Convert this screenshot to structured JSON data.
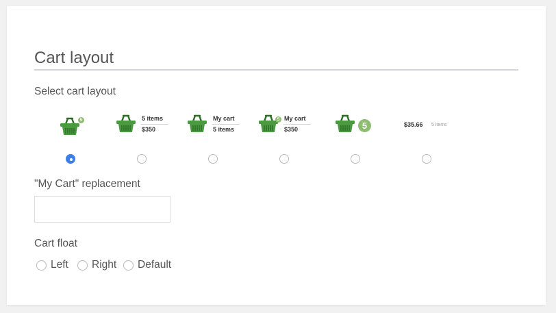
{
  "section": {
    "title": "Cart layout"
  },
  "layout": {
    "label": "Select cart layout",
    "selected_index": 0,
    "options": [
      {
        "type": "icon-badge",
        "badge": "5"
      },
      {
        "type": "icon-two-line",
        "line1": "5 items",
        "line2": "$350"
      },
      {
        "type": "icon-two-line",
        "line1": "My cart",
        "line2": "5 items"
      },
      {
        "type": "icon-badge-two-line",
        "badge": "5",
        "line1": "My cart",
        "line2": "$350"
      },
      {
        "type": "icon-big-badge",
        "badge": "5"
      },
      {
        "type": "text-only",
        "price": "$35.66",
        "count": "5 items"
      }
    ]
  },
  "replacement": {
    "label": "\"My Cart\" replacement",
    "value": "",
    "placeholder": ""
  },
  "float": {
    "label": "Cart float",
    "options": [
      "Left",
      "Right",
      "Default"
    ],
    "selected_index": -1
  },
  "colors": {
    "accent": "#3d7fe6",
    "basket_green": "#4a9a3f",
    "basket_dark": "#2e6b2a",
    "badge_green": "#8ebc71"
  },
  "icons": {
    "basket": "shopping-basket-icon"
  }
}
